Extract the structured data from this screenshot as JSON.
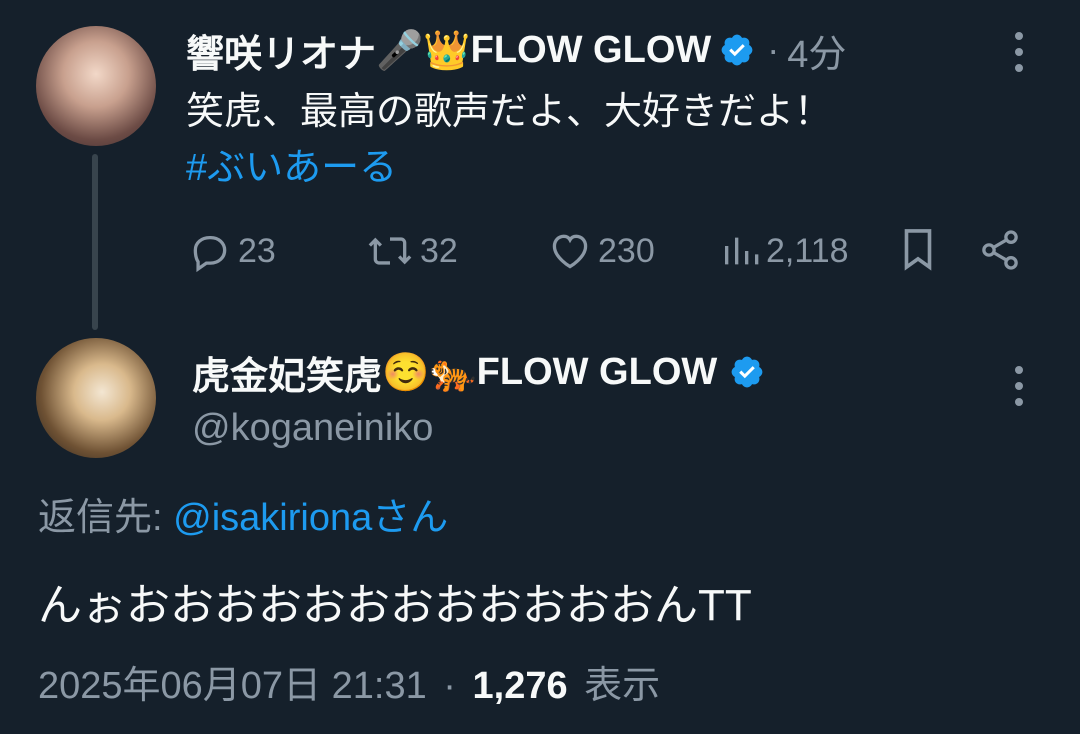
{
  "tweet1": {
    "display_name": "響咲リオナ",
    "name_emojis": "🎤👑",
    "name_suffix": "FLOW GLOW",
    "time_sep": "·",
    "time": "4分",
    "text": "笑虎、最高の歌声だよ、大好きだよ！",
    "hashtag": "#ぶいあーる",
    "actions": {
      "replies": "23",
      "retweets": "32",
      "likes": "230",
      "views": "2,118"
    }
  },
  "tweet2": {
    "display_name": "虎金妃笑虎",
    "name_emojis": "☺️🐅",
    "name_suffix": "FLOW GLOW",
    "handle": "@koganeiniko",
    "reply_to_label": "返信先:",
    "reply_to_handle": "@isakiriona",
    "reply_to_suffix": "さん",
    "text": "んぉおおおおおおおおおおおおんTT",
    "timestamp": "2025年06月07日 21:31",
    "meta_sep": "·",
    "views_count": "1,276",
    "views_label": "表示"
  },
  "colors": {
    "background": "#15202b",
    "text": "#f7f9f9",
    "muted": "#8b98a5",
    "accent": "#1d9bf0",
    "thread_line": "#38444d"
  },
  "icons": [
    "verified-badge-icon",
    "more-options-icon",
    "reply-icon",
    "retweet-icon",
    "like-icon",
    "views-icon",
    "bookmark-icon",
    "share-icon"
  ]
}
